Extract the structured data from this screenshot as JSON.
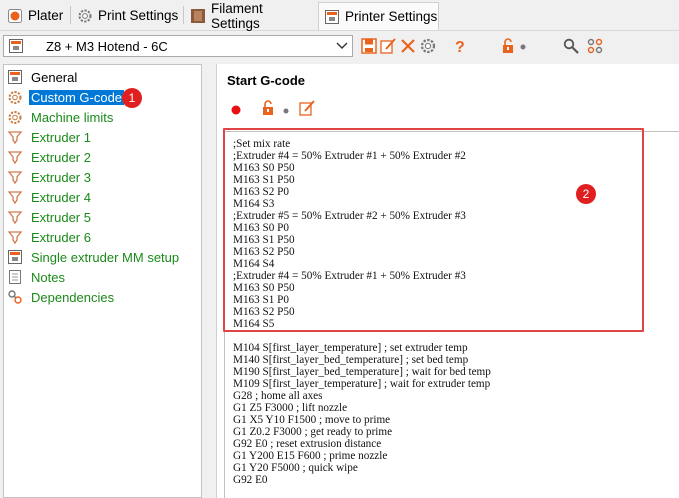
{
  "tabs": [
    {
      "label": "Plater",
      "icon": "plater-icon"
    },
    {
      "label": "Print Settings",
      "icon": "print-settings-icon"
    },
    {
      "label": "Filament Settings",
      "icon": "filament-spool-icon"
    },
    {
      "label": "Printer Settings",
      "icon": "printer-icon",
      "active": true
    }
  ],
  "preset": {
    "name": "Z8 + M3 Hotend - 6C"
  },
  "tree": {
    "items": [
      {
        "label": "General",
        "icon": "printer-icon",
        "color": "black"
      },
      {
        "label": "Custom G-code",
        "icon": "gear-icon",
        "selected": true
      },
      {
        "label": "Machine limits",
        "icon": "gear-icon"
      },
      {
        "label": "Extruder 1",
        "icon": "extruder-icon"
      },
      {
        "label": "Extruder 2",
        "icon": "extruder-icon"
      },
      {
        "label": "Extruder 3",
        "icon": "extruder-icon"
      },
      {
        "label": "Extruder 4",
        "icon": "extruder-icon"
      },
      {
        "label": "Extruder 5",
        "icon": "extruder-icon"
      },
      {
        "label": "Extruder 6",
        "icon": "extruder-icon"
      },
      {
        "label": "Single extruder MM setup",
        "icon": "printer-icon"
      },
      {
        "label": "Notes",
        "icon": "notes-icon"
      },
      {
        "label": "Dependencies",
        "icon": "wrench-icon"
      }
    ]
  },
  "annotations": {
    "badge1": "1",
    "badge2": "2"
  },
  "editor": {
    "title": "Start G-code",
    "code": ";Set mix rate\n;Extruder #4 = 50% Extruder #1 + 50% Extruder #2\nM163 S0 P50\nM163 S1 P50\nM163 S2 P0\nM164 S3\n;Extruder #5 = 50% Extruder #2 + 50% Extruder #3\nM163 S0 P0\nM163 S1 P50\nM163 S2 P50\nM164 S4\n;Extruder #4 = 50% Extruder #1 + 50% Extruder #3\nM163 S0 P50\nM163 S1 P0\nM163 S2 P50\nM164 S5\n\nM104 S[first_layer_temperature] ; set extruder temp\nM140 S[first_layer_bed_temperature] ; set bed temp\nM190 S[first_layer_bed_temperature] ; wait for bed temp\nM109 S[first_layer_temperature] ; wait for extruder temp\nG28 ; home all axes\nG1 Z5 F3000 ; lift nozzle\nG1 X5 Y10 F1500 ; move to prime\nG1 Z0.2 F3000 ; get ready to prime\nG92 E0 ; reset extrusion distance\nG1 Y200 E15 F600 ; prime nozzle\nG1 Y20 F5000 ; quick wipe\nG92 E0"
  },
  "colors": {
    "accent": "#0078d7",
    "label_green": "#1a8a1a",
    "highlight": "#e04545"
  }
}
